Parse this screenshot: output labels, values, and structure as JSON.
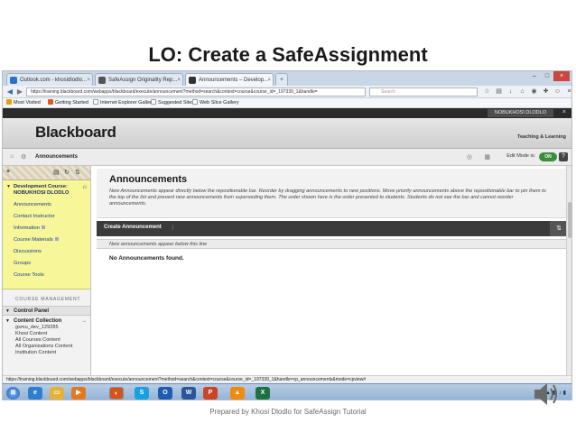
{
  "slide": {
    "title": "LO: Create a SafeAssignment",
    "footer": "Prepared by Khosi Dlodlo for SafeAssign Tutorial"
  },
  "browser": {
    "tabs": [
      {
        "label": "Outlook.com - khosidlodlo..."
      },
      {
        "label": "SafeAssign Originality Rep..."
      },
      {
        "label": "Announcements – Develop..."
      }
    ],
    "url": "https://training.blackboard.com/webapps/blackboard/execute/announcement?method=search&context=course&course_id=_197339_1&handle=",
    "search_placeholder": "Search",
    "bookmarks": [
      "Most Visited",
      "Getting Started",
      "Internet Explorer Gallery",
      "Suggested Sites",
      "Web Slice Gallery"
    ],
    "status_url": "https://training.blackboard.com/webapps/blackboard/execute/announcement?method=search&context=course&course_id=_197339_1&handle=cp_announcements&mode=cpview#"
  },
  "blackboard": {
    "user_name": "NOBUKHOSI DLODLO",
    "logo": "Blackboard",
    "top_tab": "Teaching & Learning",
    "breadcrumb": "Announcements",
    "edit_mode_label": "Edit Mode is:",
    "edit_mode_value": "ON",
    "help_label": "?"
  },
  "sidebar": {
    "course_title": "Development Course: NOBUKHOSI DLODLO",
    "menu_items": [
      {
        "label": "Announcements"
      },
      {
        "label": "Contact Instructor"
      },
      {
        "label": "Information"
      },
      {
        "label": "Course Materials"
      },
      {
        "label": "Discussions"
      },
      {
        "label": "Groups"
      },
      {
        "label": "Course Tools"
      }
    ],
    "course_management_label": "COURSE MANAGEMENT",
    "control_panel_label": "Control Panel",
    "content_collection_label": "Content Collection",
    "content_collection_items": [
      "gsmu_dev_129285",
      "Khosi Content",
      "All Courses Content",
      "All Organizations Content",
      "Institution Content"
    ]
  },
  "main": {
    "title": "Announcements",
    "description": "New Announcements appear directly below the repositionable bar. Reorder by dragging announcements to new positions. Move priority announcements above the repositionable bar to pin them to the top of the list and prevent new announcements from superseding them. The order shown here is the order presented to students. Students do not see the bar and cannot reorder announcements.",
    "create_button": "Create Announcement",
    "reposition_bar": "New announcements appear below this line",
    "empty_message": "No Announcements found."
  },
  "taskbar": {
    "icons": [
      "start-icon",
      "ie-icon",
      "explorer-icon",
      "media-icon",
      "firefox-icon",
      "skype-icon",
      "outlook-icon",
      "word-icon",
      "powerpoint-icon",
      "vlc-icon",
      "excel-icon"
    ],
    "colors": {
      "accent_green": "#3a8d3a",
      "menu_yellow": "#f7f799",
      "action_dark": "#3b3b3b"
    }
  }
}
